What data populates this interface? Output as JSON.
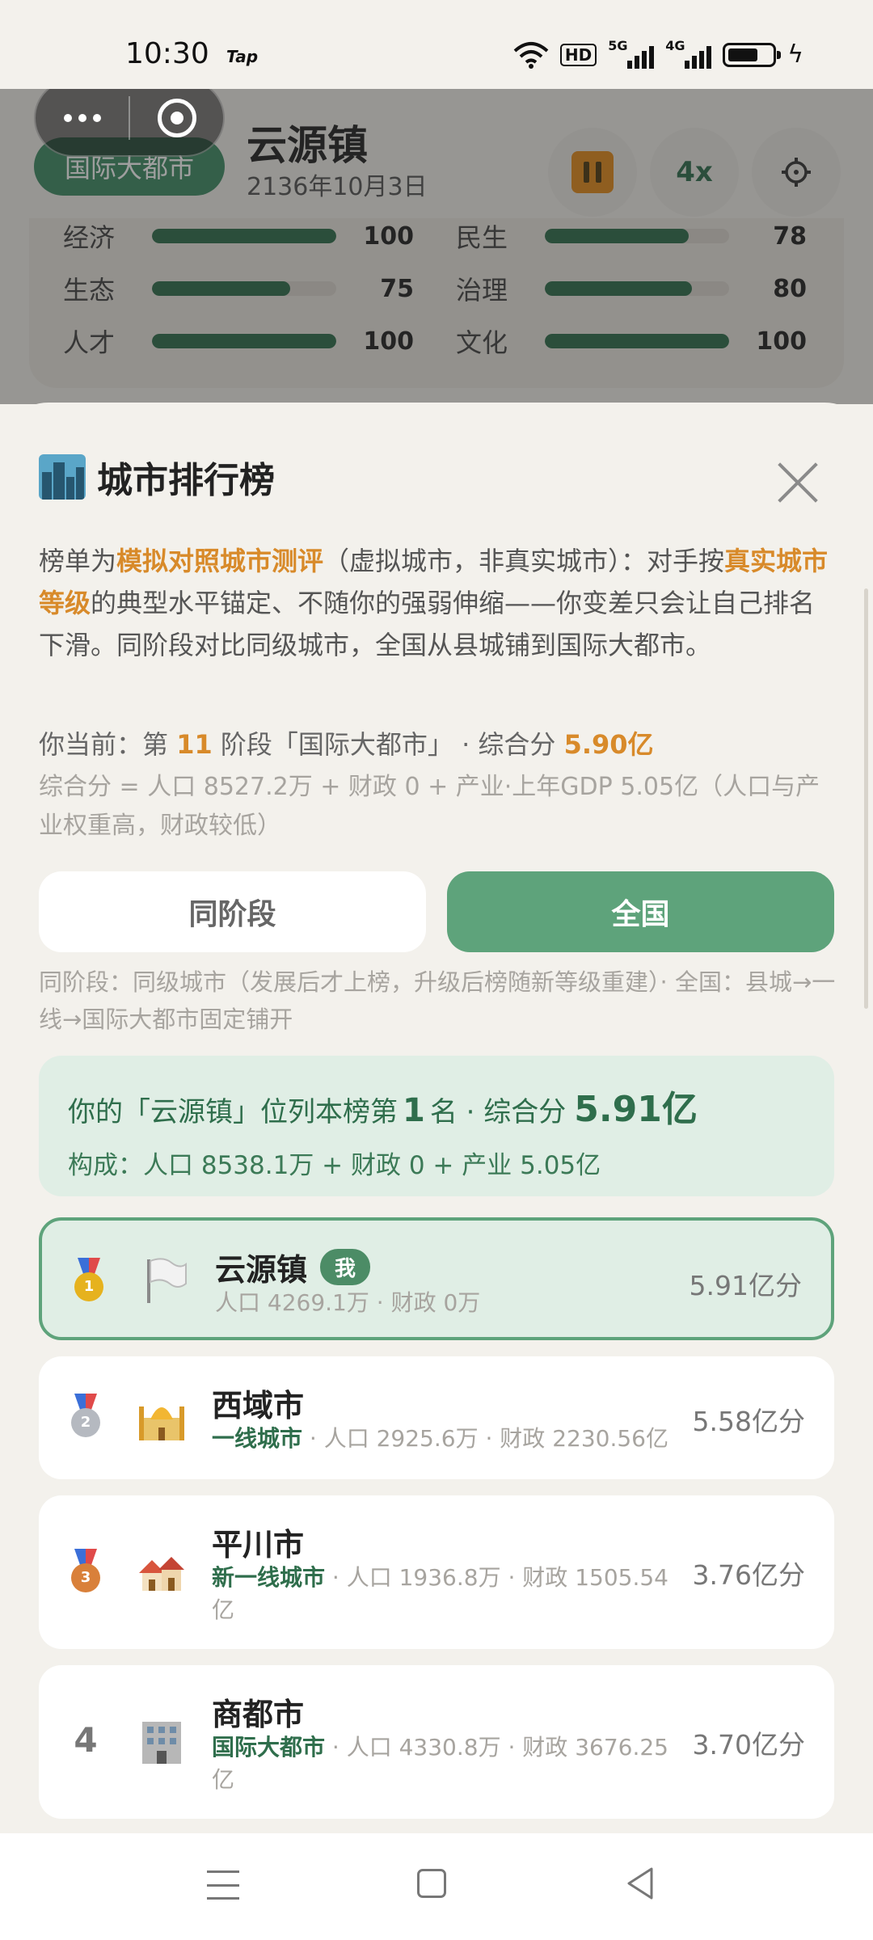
{
  "status_bar": {
    "time": "10:30",
    "tap": "Tap",
    "hd": "HD",
    "sig1": "5G",
    "sig2": "4G"
  },
  "header": {
    "stage_label": "国际大都市",
    "city_name": "云源镇",
    "date": "2136年10月3日",
    "speed": "4x",
    "stats": [
      {
        "label": "经济",
        "value": "100",
        "fill": 1.0
      },
      {
        "label": "民生",
        "value": "78",
        "fill": 0.78
      },
      {
        "label": "生态",
        "value": "75",
        "fill": 0.75
      },
      {
        "label": "治理",
        "value": "80",
        "fill": 0.8
      },
      {
        "label": "人才",
        "value": "100",
        "fill": 1.0
      },
      {
        "label": "文化",
        "value": "100",
        "fill": 1.0
      }
    ]
  },
  "sheet": {
    "title": "城市排行榜",
    "intro": {
      "p1": "榜单为",
      "h1": "模拟对照城市测评",
      "p2": "（虚拟城市，非真实城市）：对手按",
      "h2": "真实城市等级",
      "p3": "的典型水平锚定、不随你的强弱伸缩——你变差只会让自己排名下滑。同阶段对比同级城市，全国从县城铺到国际大都市。"
    },
    "current": {
      "prefix": "你当前：第 ",
      "stage_num": "11",
      "middle": " 阶段「国际大都市」 · 综合分 ",
      "score": "5.90亿"
    },
    "formula": "综合分 = 人口 8527.2万 + 财政 0 + 产业·上年GDP 5.05亿（人口与产业权重高，财政较低）",
    "tabs": {
      "same_stage": "同阶段",
      "national": "全国"
    },
    "tab_note": "同阶段：同级城市（发展后才上榜，升级后榜随新等级重建）· 全国：县城→一线→国际大都市固定铺开",
    "summary": {
      "pre": "你的「云源镇」位列本榜第",
      "rank": "1",
      "mid": "名 · 综合分",
      "score": "5.91亿",
      "composition": "构成：人口 8538.1万 + 财政 0 + 产业 5.05亿"
    },
    "rows": [
      {
        "rank": "1",
        "icon": "white-flag",
        "name": "云源镇",
        "badge": "我",
        "level": "",
        "detail": "人口 4269.1万 · 财政 0万",
        "score": "5.91亿分"
      },
      {
        "rank": "2",
        "icon": "mosque",
        "name": "西域市",
        "level": "一线城市",
        "detail": " · 人口 2925.6万 · 财政 2230.56亿",
        "score": "5.58亿分"
      },
      {
        "rank": "3",
        "icon": "houses",
        "name": "平川市",
        "level": "新一线城市",
        "detail": " · 人口 1936.8万 · 财政 1505.54亿",
        "score": "3.76亿分"
      },
      {
        "rank": "4",
        "icon": "office-building",
        "name": "商都市",
        "level": "国际大都市",
        "detail": " · 人口 4330.8万 · 财政 3676.25亿",
        "score": "3.70亿分"
      }
    ]
  },
  "colors": {
    "accent_green": "#5ea37b",
    "dark_green": "#2f6e4c",
    "highlight_orange": "#d88a2a",
    "background": "#f3f1ec"
  }
}
